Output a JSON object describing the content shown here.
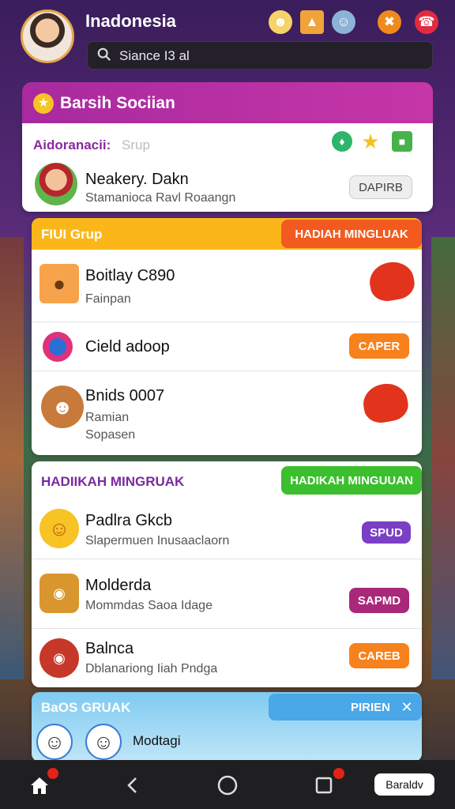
{
  "app": {
    "title": "Inadonesia"
  },
  "search": {
    "value": "Siance I3 al"
  },
  "panel": {
    "title": "Barsih Sociian"
  },
  "admin": {
    "label": "Aidoranacii:",
    "placeholder": "Srup",
    "user": {
      "name": "Neakery. Dakn",
      "sub": "Stamanioca Ravl Roaangn",
      "button": "DAPIRB"
    }
  },
  "group1": {
    "label": "FIUI Grup",
    "tag": "HADIAH MINGLUAK",
    "rows": [
      {
        "name": "Boitlay C890",
        "sub": "Fainpan"
      },
      {
        "name": "Cield adoop",
        "button": "CAPER"
      },
      {
        "name": "Bnids 0007",
        "sub": "Ramian",
        "sub2": "Sopasen"
      }
    ]
  },
  "group2": {
    "label": "HADIIKAH MINGRUAK",
    "tag": "HADIKAH MINGUUAN",
    "rows": [
      {
        "name": "Padlra Gkcb",
        "sub": "Slapermuen Inusaaclaorn",
        "button": "SPUD"
      },
      {
        "name": "Molderda",
        "sub": "Mommdas Saoa Idage",
        "button": "SAPMD"
      },
      {
        "name": "Balnca",
        "sub": "Dblanariong Iiah Pndga",
        "button": "CAREB"
      }
    ]
  },
  "group3": {
    "label": "BaOS GRUAK",
    "tag": "PIRIEN",
    "name": "Modtagi"
  },
  "nav": {
    "pill": "Baraldv"
  },
  "colors": {
    "orange": "#f7811c",
    "purple": "#8f2aa0",
    "green": "#3cbf2e",
    "violet": "#7a3fc4",
    "magenta": "#a8287a"
  }
}
